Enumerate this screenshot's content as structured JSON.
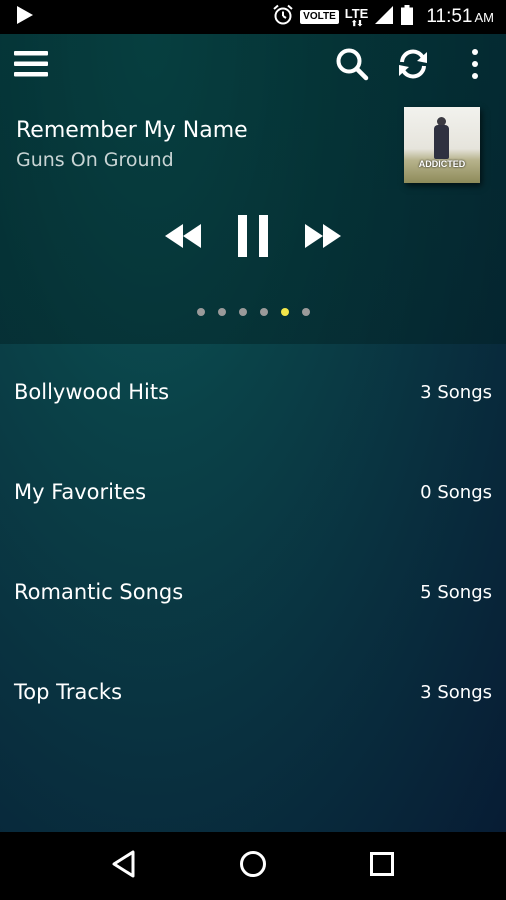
{
  "status_bar": {
    "volte": "VOLTE",
    "network": "LTE",
    "time": "11:51",
    "ampm": "AM",
    "icons": [
      "play-icon",
      "alarm-icon",
      "signal-icon",
      "battery-icon"
    ]
  },
  "toolbar": {
    "icons": [
      "menu-icon",
      "search-icon",
      "refresh-icon",
      "more-vert-icon"
    ]
  },
  "now_playing": {
    "title": "Remember My Name",
    "artist": "Guns On Ground",
    "album_text": "ADDICTED",
    "controls": [
      "rewind-icon",
      "pause-icon",
      "fast-forward-icon"
    ],
    "pages_total": 6,
    "active_page": 5
  },
  "playlists": [
    {
      "name": "Bollywood Hits",
      "count": "3 Songs"
    },
    {
      "name": "My Favorites",
      "count": "0 Songs"
    },
    {
      "name": "Romantic Songs",
      "count": "5 Songs"
    },
    {
      "name": "Top Tracks",
      "count": "3 Songs"
    }
  ],
  "nav_bar": {
    "icons": [
      "back-icon",
      "home-icon",
      "recents-icon"
    ]
  },
  "colors": {
    "accent_dot": "#f2e64a",
    "background_top": "#0e5a5c",
    "background_bottom": "#071c34"
  }
}
